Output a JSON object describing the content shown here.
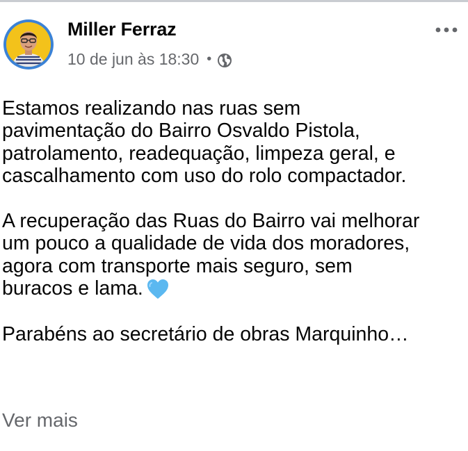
{
  "post": {
    "author": "Miller Ferraz",
    "timestamp": "10 de jun às 18:30",
    "meta_separator": "•",
    "privacy_icon": "globe-icon",
    "more_icon": "more-horizontal-icon",
    "paragraphs": [
      {
        "lines": [
          "Estamos realizando nas ruas sem",
          "pavimentação do Bairro Osvaldo Pistola,",
          "patrolamento, readequação, limpeza geral, e",
          "cascalhamento com uso do rolo compactador."
        ]
      },
      {
        "lines": [
          "A recuperação das Ruas do Bairro vai melhorar",
          "um pouco a qualidade de vida dos moradores,",
          "agora com transporte mais seguro, sem",
          "buracos e lama."
        ],
        "emoji": "blue-heart-emoji"
      },
      {
        "lines": [
          "Parabéns ao secretário de obras Marquinho…"
        ]
      }
    ],
    "see_more": "Ver mais"
  },
  "colors": {
    "text": "#050505",
    "secondary_text": "#65676b",
    "avatar_ring": "#3b82d6",
    "avatar_bg": "#f3c21b",
    "heart": "#5bb8f0"
  }
}
